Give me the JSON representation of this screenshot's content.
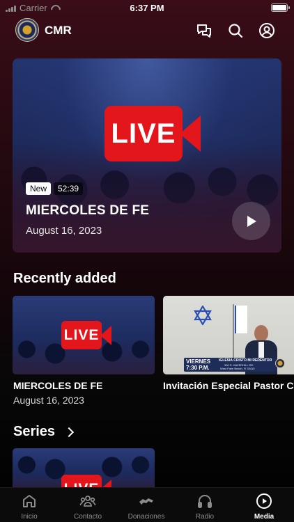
{
  "status_bar": {
    "carrier": "Carrier",
    "time": "6:37 PM"
  },
  "header": {
    "title": "CMR"
  },
  "featured": {
    "badge": "New",
    "duration": "52:39",
    "title": "MIERCOLES DE FE",
    "date": "August 16, 2023",
    "live_label": "LIVE"
  },
  "recently_added": {
    "heading": "Recently added",
    "items": [
      {
        "title": "MIERCOLES DE FE",
        "date": "August 16, 2023",
        "live_label": "LIVE"
      },
      {
        "title": "Invitación Especial Pastor C",
        "overlay_day": "VIERNES",
        "overlay_time": "7:30 P.M.",
        "overlay_church": "IGLESIA CRISTO MI REDENTOR",
        "overlay_addr1": "300 S. HAVERHILL RD",
        "overlay_addr2": "West Palm Beach, Fl 33415"
      }
    ]
  },
  "series": {
    "heading": "Series",
    "live_label": "LIVE"
  },
  "tabbar": {
    "tabs": [
      {
        "label": "Inicio",
        "icon": "home-icon"
      },
      {
        "label": "Contacto",
        "icon": "people-icon"
      },
      {
        "label": "Donaciones",
        "icon": "handshake-icon"
      },
      {
        "label": "Radio",
        "icon": "headphones-icon"
      },
      {
        "label": "Media",
        "icon": "play-circle-icon"
      }
    ],
    "active": "Media"
  },
  "colors": {
    "live_red": "#e3161c",
    "background_top": "#3a0d18",
    "tab_inactive": "#8c8c8c"
  }
}
